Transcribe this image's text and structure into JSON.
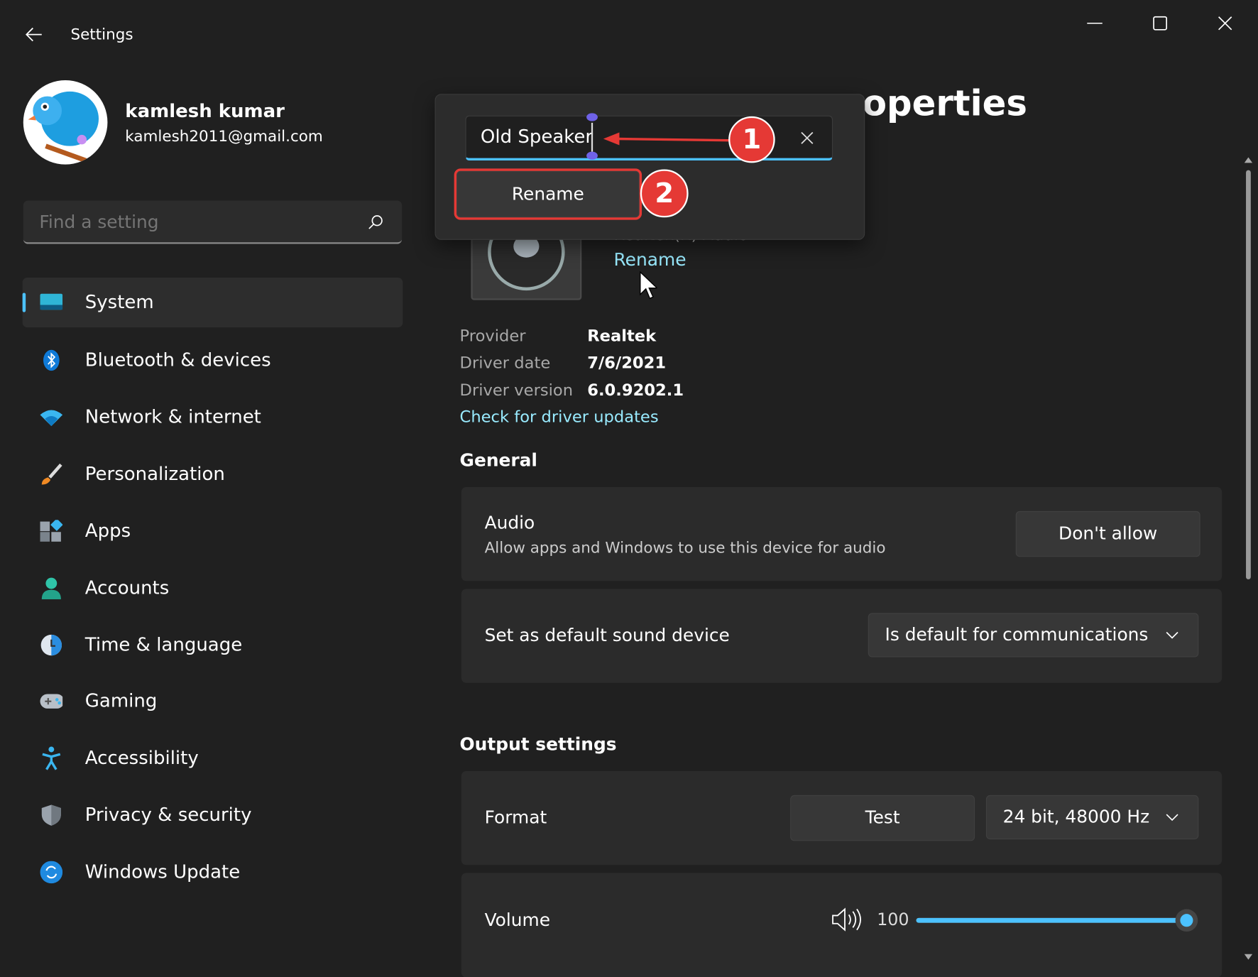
{
  "window": {
    "title": "Settings",
    "back_icon": "arrow-left-icon",
    "controls": [
      "minimize-icon",
      "maximize-icon",
      "close-icon"
    ]
  },
  "profile": {
    "name": "kamlesh kumar",
    "email": "kamlesh2011@gmail.com"
  },
  "search": {
    "placeholder": "Find a setting"
  },
  "sidebar": {
    "items": [
      {
        "label": "System",
        "icon": "monitor-icon",
        "active": true
      },
      {
        "label": "Bluetooth & devices",
        "icon": "bluetooth-icon"
      },
      {
        "label": "Network & internet",
        "icon": "wifi-icon"
      },
      {
        "label": "Personalization",
        "icon": "brush-icon"
      },
      {
        "label": "Apps",
        "icon": "apps-icon"
      },
      {
        "label": "Accounts",
        "icon": "person-icon"
      },
      {
        "label": "Time & language",
        "icon": "clock-globe-icon"
      },
      {
        "label": "Gaming",
        "icon": "gamepad-icon"
      },
      {
        "label": "Accessibility",
        "icon": "accessibility-icon"
      },
      {
        "label": "Privacy & security",
        "icon": "shield-icon"
      },
      {
        "label": "Windows Update",
        "icon": "update-icon"
      }
    ]
  },
  "page": {
    "title_visible": "operties",
    "device_subtitle": "Realtek(R) Audio",
    "rename_link": "Rename"
  },
  "rename_popup": {
    "value": "Old Speaker",
    "button": "Rename",
    "callouts": [
      "1",
      "2"
    ]
  },
  "driver": {
    "rows": [
      {
        "label": "Provider",
        "value": "Realtek"
      },
      {
        "label": "Driver date",
        "value": "7/6/2021"
      },
      {
        "label": "Driver version",
        "value": "6.0.9202.1"
      }
    ],
    "check_link": "Check for driver updates"
  },
  "general": {
    "heading": "General",
    "audio": {
      "title": "Audio",
      "desc": "Allow apps and Windows to use this device for audio",
      "button": "Don't allow"
    },
    "default": {
      "title": "Set as default sound device",
      "selected": "Is default for communications"
    }
  },
  "output": {
    "heading": "Output settings",
    "format": {
      "title": "Format",
      "test": "Test",
      "selected": "24 bit, 48000 Hz"
    },
    "volume": {
      "title": "Volume",
      "value": "100",
      "level": 100
    }
  },
  "colors": {
    "accent": "#4cc2ff",
    "link": "#99ebff",
    "callout": "#e53935"
  }
}
